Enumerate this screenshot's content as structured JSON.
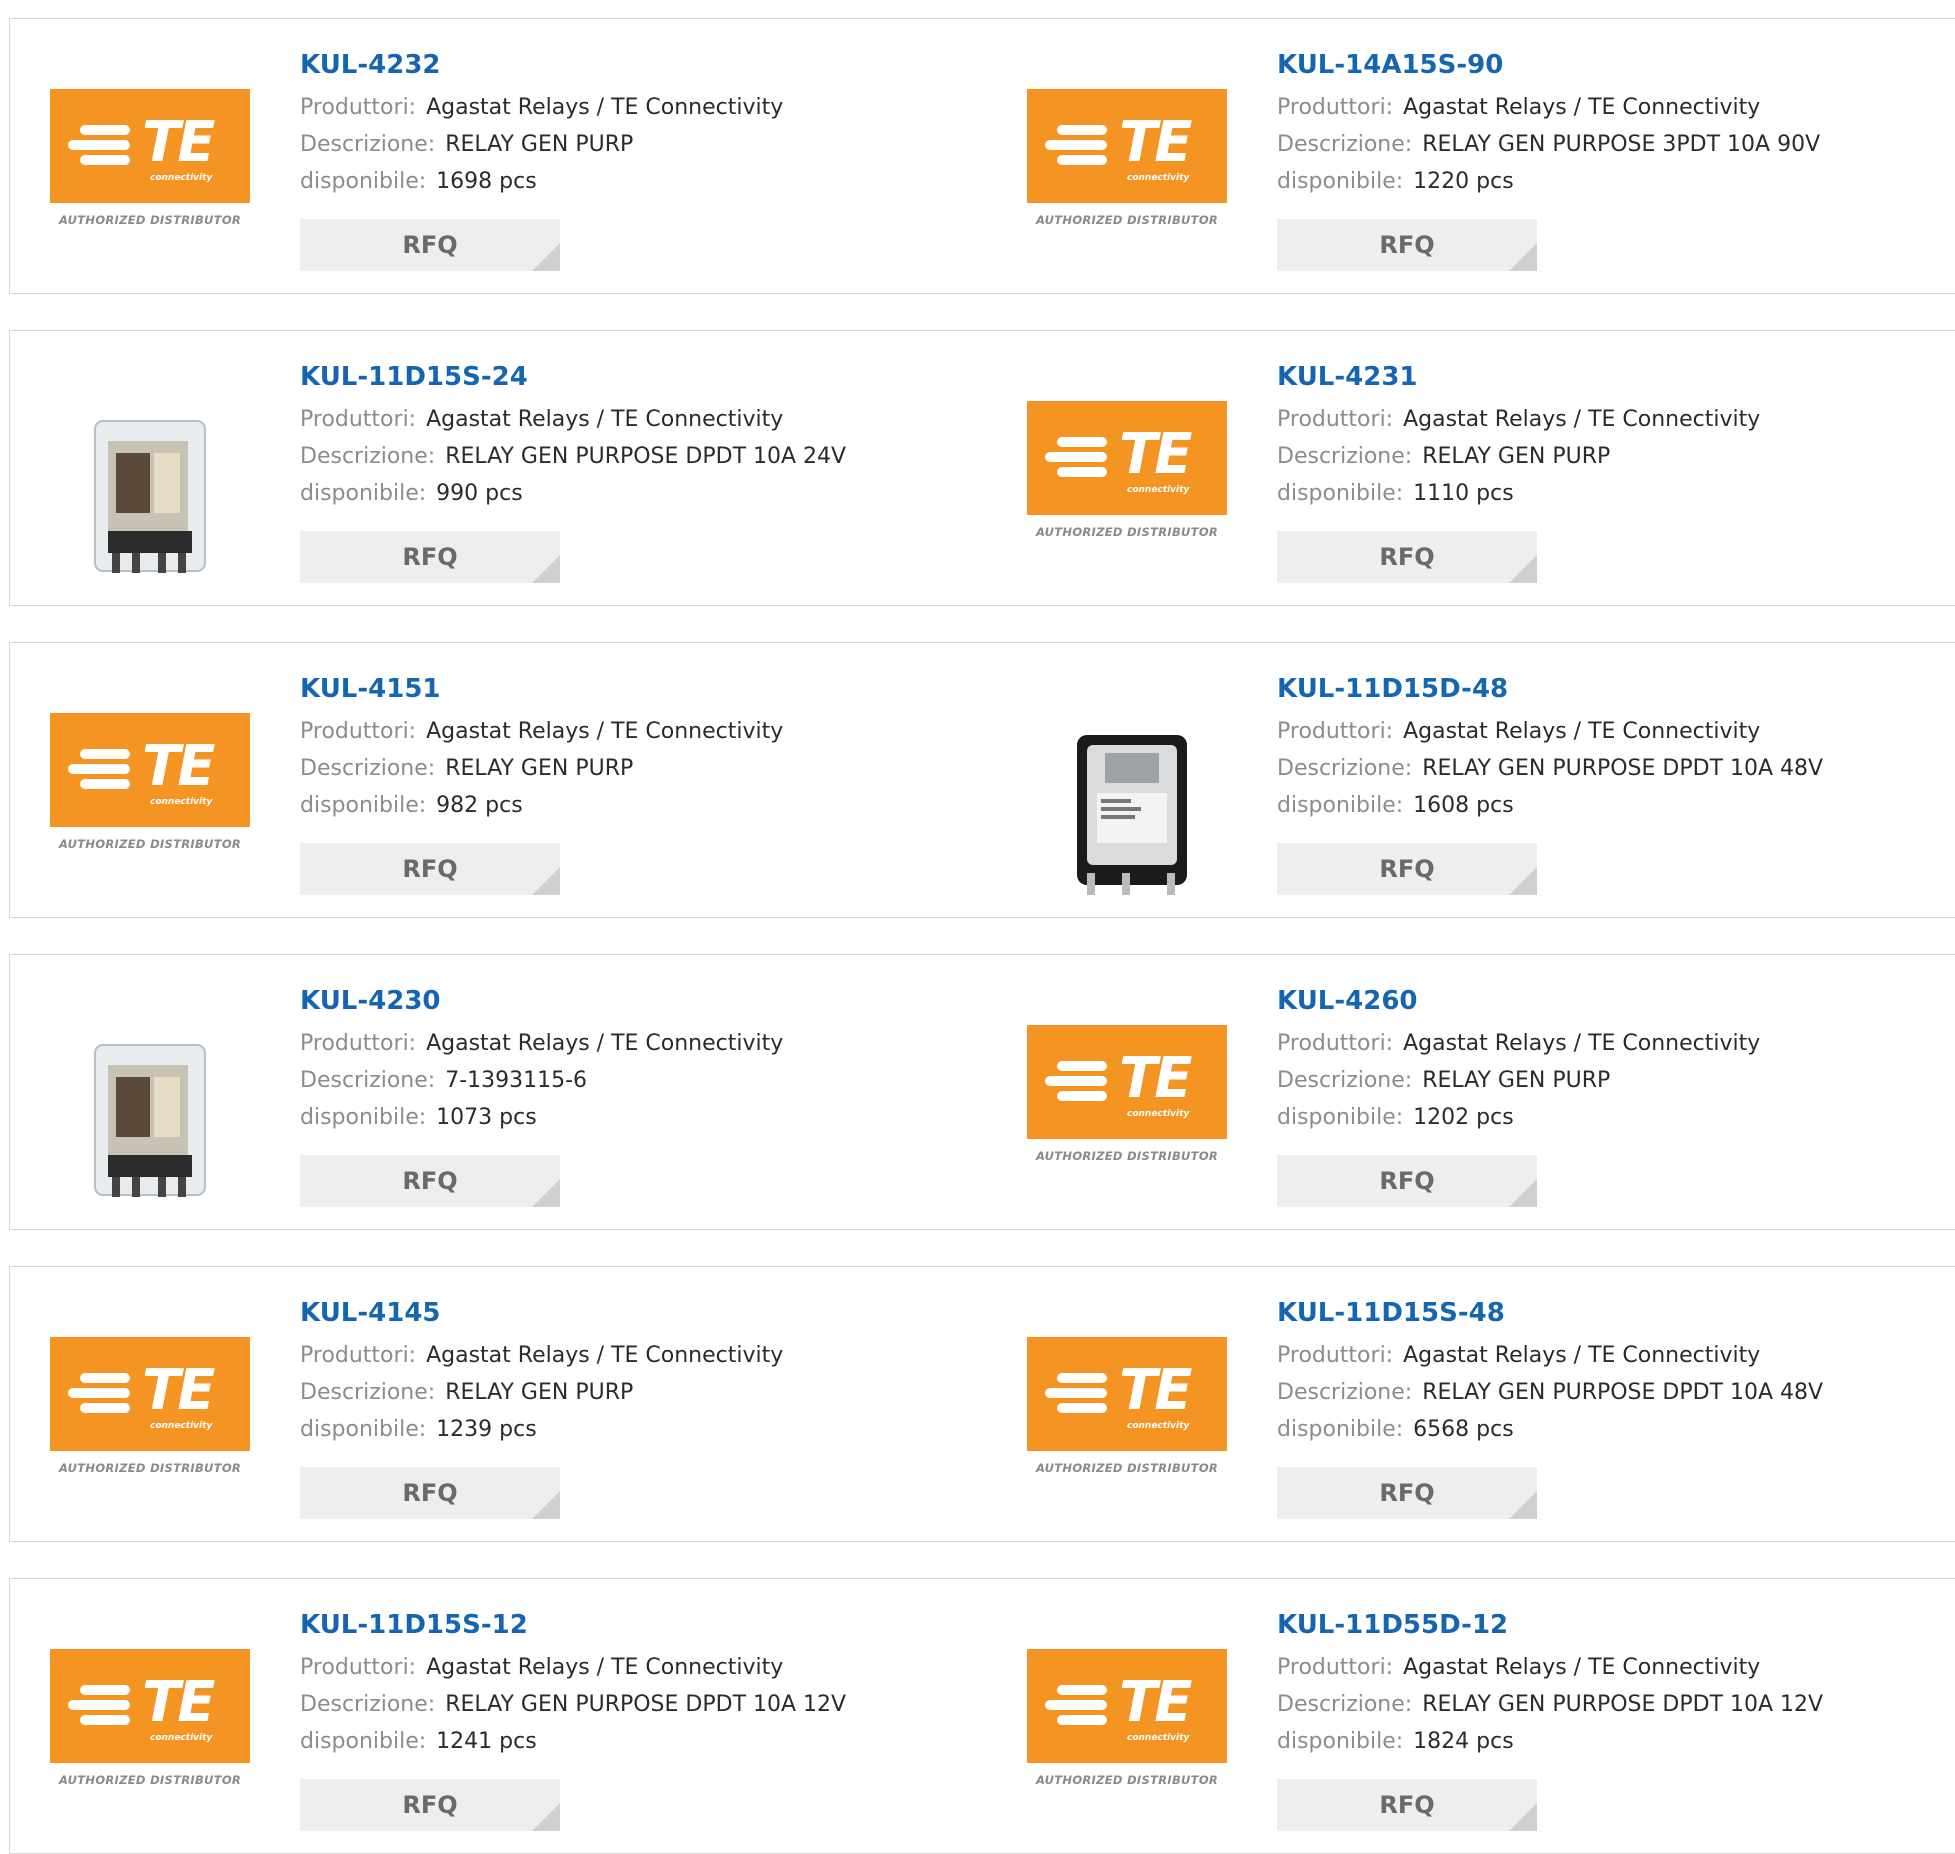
{
  "labels": {
    "manufacturer": "Produttori:",
    "description": "Descrizione:",
    "available": "disponibile:",
    "rfq": "RFQ"
  },
  "logo": {
    "brand": "TE",
    "sub": "connectivity",
    "authorized": "AUTHORIZED DISTRIBUTOR"
  },
  "colors": {
    "part_link": "#1565b0",
    "logo_orange": "#f39423",
    "rfq_bg": "#eeeeee"
  },
  "products": [
    {
      "part": "KUL-4232",
      "manufacturer": "Agastat Relays / TE Connectivity",
      "description": "RELAY GEN PURP",
      "available": "1698 pcs",
      "image": "te-logo"
    },
    {
      "part": "KUL-14A15S-90",
      "manufacturer": "Agastat Relays / TE Connectivity",
      "description": "RELAY GEN PURPOSE 3PDT 10A 90V",
      "available": "1220 pcs",
      "image": "te-logo"
    },
    {
      "part": "KUL-11D15S-24",
      "manufacturer": "Agastat Relays / TE Connectivity",
      "description": "RELAY GEN PURPOSE DPDT 10A 24V",
      "available": "990 pcs",
      "image": "relay-photo"
    },
    {
      "part": "KUL-4231",
      "manufacturer": "Agastat Relays / TE Connectivity",
      "description": "RELAY GEN PURP",
      "available": "1110 pcs",
      "image": "te-logo"
    },
    {
      "part": "KUL-4151",
      "manufacturer": "Agastat Relays / TE Connectivity",
      "description": "RELAY GEN PURP",
      "available": "982 pcs",
      "image": "te-logo"
    },
    {
      "part": "KUL-11D15D-48",
      "manufacturer": "Agastat Relays / TE Connectivity",
      "description": "RELAY GEN PURPOSE DPDT 10A 48V",
      "available": "1608 pcs",
      "image": "relay-photo-black"
    },
    {
      "part": "KUL-4230",
      "manufacturer": "Agastat Relays / TE Connectivity",
      "description": "7-1393115-6",
      "available": "1073 pcs",
      "image": "relay-photo"
    },
    {
      "part": "KUL-4260",
      "manufacturer": "Agastat Relays / TE Connectivity",
      "description": "RELAY GEN PURP",
      "available": "1202 pcs",
      "image": "te-logo"
    },
    {
      "part": "KUL-4145",
      "manufacturer": "Agastat Relays / TE Connectivity",
      "description": "RELAY GEN PURP",
      "available": "1239 pcs",
      "image": "te-logo"
    },
    {
      "part": "KUL-11D15S-48",
      "manufacturer": "Agastat Relays / TE Connectivity",
      "description": "RELAY GEN PURPOSE DPDT 10A 48V",
      "available": "6568 pcs",
      "image": "te-logo"
    },
    {
      "part": "KUL-11D15S-12",
      "manufacturer": "Agastat Relays / TE Connectivity",
      "description": "RELAY GEN PURPOSE DPDT 10A 12V",
      "available": "1241 pcs",
      "image": "te-logo"
    },
    {
      "part": "KUL-11D55D-12",
      "manufacturer": "Agastat Relays / TE Connectivity",
      "description": "RELAY GEN PURPOSE DPDT 10A 12V",
      "available": "1824 pcs",
      "image": "te-logo"
    }
  ]
}
